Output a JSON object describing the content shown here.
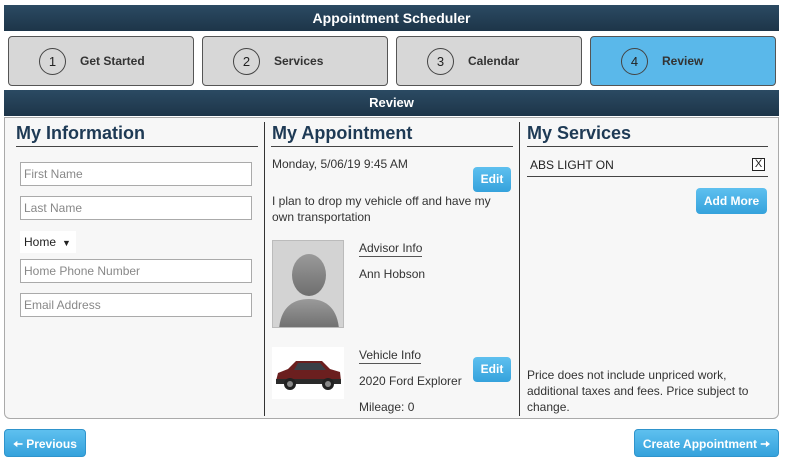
{
  "header": {
    "title": "Appointment Scheduler"
  },
  "steps": [
    {
      "number": "1",
      "label": "Get Started",
      "active": false
    },
    {
      "number": "2",
      "label": "Services",
      "active": false
    },
    {
      "number": "3",
      "label": "Calendar",
      "active": false
    },
    {
      "number": "4",
      "label": "Review",
      "active": true
    }
  ],
  "section": {
    "title": "Review"
  },
  "my_information": {
    "heading": "My Information",
    "first_name_placeholder": "First Name",
    "last_name_placeholder": "Last Name",
    "phone_type": "Home",
    "phone_placeholder": "Home Phone Number",
    "email_placeholder": "Email Address"
  },
  "my_appointment": {
    "heading": "My Appointment",
    "datetime": "Monday, 5/06/19 9:45 AM",
    "edit_label": "Edit",
    "transport_line1": "I plan to drop my vehicle off and have my",
    "transport_line2": "own transportation",
    "advisor_link": "Advisor Info",
    "advisor_name": "Ann Hobson",
    "vehicle_link": "Vehicle Info",
    "vehicle_name": "2020 Ford Explorer",
    "mileage": "Mileage: 0",
    "vehicle_edit_label": "Edit"
  },
  "my_services": {
    "heading": "My Services",
    "items": [
      {
        "name": "ABS LIGHT ON",
        "remove": "X"
      }
    ],
    "add_more_label": "Add More",
    "disclaimer_line1": "Price does not include unpriced work,",
    "disclaimer_line2": "additional taxes and fees. Price subject to",
    "disclaimer_line3": "change."
  },
  "footer": {
    "previous_label": "Previous",
    "create_label": "Create Appointment"
  },
  "colors": {
    "header": "#1d3549",
    "accent": "#5ab8ea",
    "button": "#35a2dc"
  }
}
